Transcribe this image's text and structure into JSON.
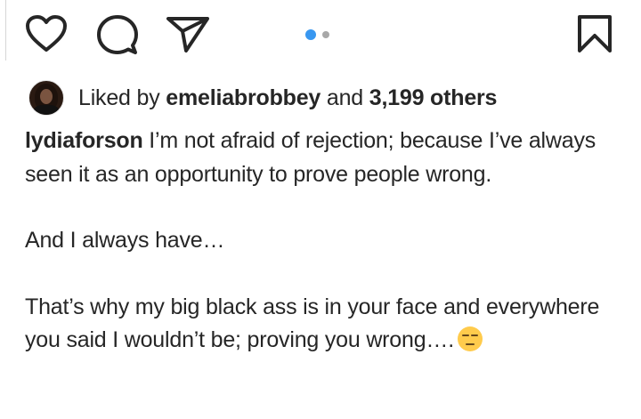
{
  "actions": {
    "like_icon": "heart-icon",
    "comment_icon": "comment-bubble-icon",
    "share_icon": "paper-plane-icon",
    "save_icon": "bookmark-icon"
  },
  "carousel": {
    "total": 2,
    "active": 1,
    "active_color": "#3897f0",
    "inactive_color": "#a8a8a8"
  },
  "likes": {
    "prefix": "Liked by",
    "user": "emeliabrobbey",
    "connector": "and",
    "others": "3,199 others"
  },
  "caption": {
    "username": "lydiaforson",
    "line1": "I’m not afraid of rejection; because I’ve always seen it as an opportunity to prove people wrong.",
    "line2": "And I always have…",
    "line3": "That’s why my big black ass is in your face and everywhere you said I wouldn’t be; proving you wrong….",
    "emoji": "expressionless-face-emoji"
  }
}
